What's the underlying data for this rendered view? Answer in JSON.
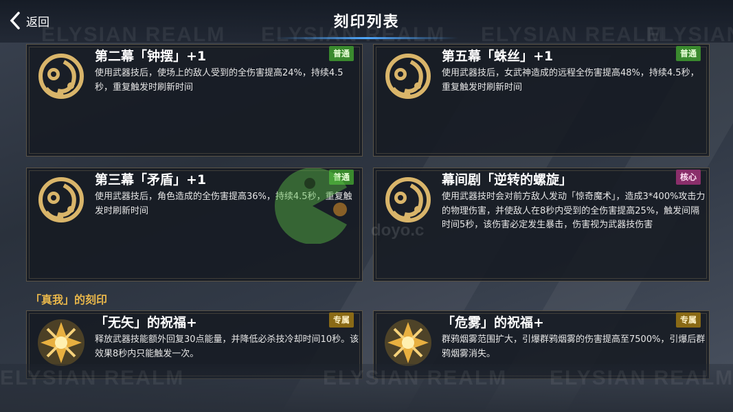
{
  "header": {
    "back_label": "返回",
    "title": "刻印列表",
    "watermark": "ELYSIAN REALM"
  },
  "cards": [
    {
      "title": "第二幕「钟摆」+1",
      "badge": "普通",
      "desc": "使用武器技后，使场上的敌人受到的全伤害提高24%，持续4.5秒，重复触发时刷新时间",
      "icon": "ornate-emblem-icon"
    },
    {
      "title": "第五幕「蛛丝」+1",
      "badge": "普通",
      "desc": "使用武器技后，女武神造成的远程全伤害提高48%，持续4.5秒，重复触发时刷新时间",
      "icon": "ornate-emblem-icon"
    },
    {
      "title": "第三幕「矛盾」+1",
      "badge": "普通",
      "desc": "使用武器技后，角色造成的全伤害提高36%，持续4.5秒，重复触发时刷新时间",
      "icon": "ornate-emblem-icon"
    },
    {
      "title": "幕间剧「逆转的螺旋」",
      "badge": "核心",
      "desc": "使用武器技时会对前方敌人发动「惊奇魔术」，造成3*400%攻击力的物理伤害，并使敌人在8秒内受到的全伤害提高25%，触发间隔时间5秒，该伤害必定发生暴击，伤害视为武器技伤害",
      "icon": "ornate-emblem-icon"
    }
  ],
  "section": {
    "label": "「真我」的刻印"
  },
  "blessings": [
    {
      "title": "「无矢」的祝福+",
      "badge": "专属",
      "desc": "释放武器技能额外回复30点能量，并降低必杀技冷却时间10秒。该效果8秒内只能触发一次。",
      "icon": "golden-flower-emblem-icon"
    },
    {
      "title": "「危雾」的祝福+",
      "badge": "专属",
      "desc": "群鸦烟雾范围扩大，引爆群鸦烟雾的伤害提高至7500%，引爆后群鸦烟雾消失。",
      "icon": "golden-flower-emblem-icon"
    }
  ],
  "overlay": {
    "site_watermark": "doyo.c"
  },
  "colors": {
    "badge_normal": "#3a8a2e",
    "badge_core": "#8a2e6a",
    "badge_special": "#8a6a16",
    "section_label": "#e8b64a",
    "emblem_gold": "#d9b56a"
  }
}
